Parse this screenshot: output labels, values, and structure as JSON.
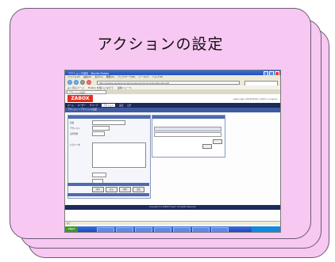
{
  "slide": {
    "title": "アクションの設定"
  },
  "colors": {
    "card_fill": "#f7c8f1",
    "card_border": "#6a5a74",
    "app_nav": "#1c2a5c",
    "logo_red": "#e52e1f"
  },
  "screenshot": {
    "window_title": "アクションの設定 - Mozilla Firefox",
    "menus": [
      "ファイル(F)",
      "編集(E)",
      "表示(V)",
      "履歴(S)",
      "ブックマーク(B)",
      "ツール(T)",
      "ヘルプ(H)"
    ],
    "url": "http://sample.example.jp/carbo/index.php?cmd=action&mode=edit",
    "bookmarks": [
      "よく見るページ",
      "Firefox を使いこなそう",
      "最新ニュース"
    ],
    "tab_label": "アクションの設定",
    "logo": "ZABOX",
    "user_info": "Last Login 2012/01/24 | Admin | Logout",
    "nav_items": [
      "ホーム",
      "ユーザー",
      "グループ",
      "アクション",
      "設定",
      "ログ"
    ],
    "subnav": "アクション > アクションの設定",
    "form_labels": [
      "名前",
      "アクション",
      "実行条件",
      "パラメータ"
    ],
    "buttons": [
      "保存",
      "戻る",
      "削除",
      "追加"
    ],
    "footer": "Copyright (C) ZABOX Project. All Rights Reserved.",
    "status": "完了",
    "start_label": "start"
  }
}
